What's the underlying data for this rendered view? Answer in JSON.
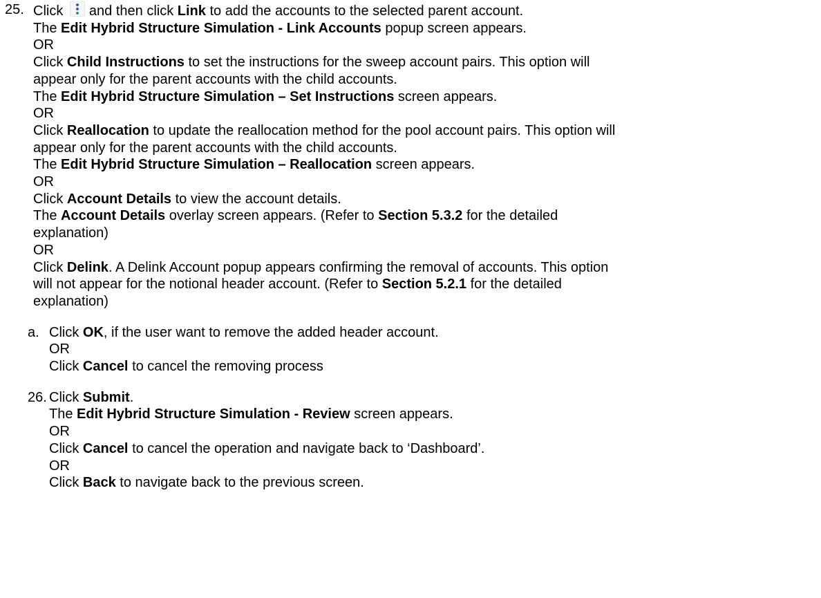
{
  "step25": {
    "number": "25.",
    "line1": {
      "pre": "Click",
      "icon": "kebab-menu-icon",
      "mid": "and then click",
      "link": "Link",
      "post": "to add the accounts to the selected parent account."
    },
    "line2": {
      "pre": "The",
      "bold": "Edit Hybrid Structure Simulation - Link Accounts",
      "post": "popup screen appears."
    },
    "or1": "OR",
    "line3": {
      "pre": "Click",
      "bold": "Child Instructions",
      "post": "to set the instructions for the sweep account pairs. This option will",
      "cont": "appear only for the parent accounts with the child accounts."
    },
    "line4": {
      "pre": "The",
      "bold": "Edit Hybrid Structure Simulation – Set Instructions",
      "post": "screen appears."
    },
    "or2": "OR",
    "line5": {
      "pre": "Click",
      "bold": "Reallocation",
      "post": "to update the reallocation method for the pool account pairs. This option will",
      "cont": "appear only for the parent accounts with the child accounts."
    },
    "line6": {
      "pre": "The",
      "bold": "Edit Hybrid Structure Simulation – Reallocation",
      "post": "screen appears."
    },
    "or3": "OR",
    "line7": {
      "pre": "Click",
      "bold": "Account Details",
      "post": "to view the account details."
    },
    "line8": {
      "pre": "The",
      "bold": "Account Details",
      "mid": "overlay screen appears. (Refer to",
      "bold2": "Section 5.3.2",
      "post": "for the detailed",
      "cont": "explanation)"
    },
    "or4": "OR",
    "line9": {
      "pre": "Click",
      "bold": "Delink",
      "post": ". A Delink Account popup appears confirming the removal of accounts. This option",
      "cont_pre": "will not appear for the notional header account. (Refer to",
      "bold2": "Section 5.2.1",
      "cont_post": "for the detailed",
      "cont2": "explanation)"
    }
  },
  "substep_a": {
    "letter": "a.",
    "line1": {
      "pre": "Click",
      "bold": "OK",
      "post": ", if the user want to remove the added header account."
    },
    "or": "OR",
    "line2": {
      "pre": "Click",
      "bold": "Cancel",
      "post": "to cancel the removing process"
    }
  },
  "step26": {
    "number": "26.",
    "line1": {
      "pre": "Click",
      "bold": "Submit",
      "post": "."
    },
    "line2": {
      "pre": "The",
      "bold": "Edit Hybrid Structure Simulation - Review",
      "post": "screen appears."
    },
    "or1": "OR",
    "line3": {
      "pre": "Click",
      "bold": "Cancel",
      "post": "to cancel the operation and navigate back to ‘Dashboard’."
    },
    "or2": "OR",
    "line4": {
      "pre": "Click",
      "bold": "Back",
      "post": "to navigate back to the previous screen."
    }
  }
}
